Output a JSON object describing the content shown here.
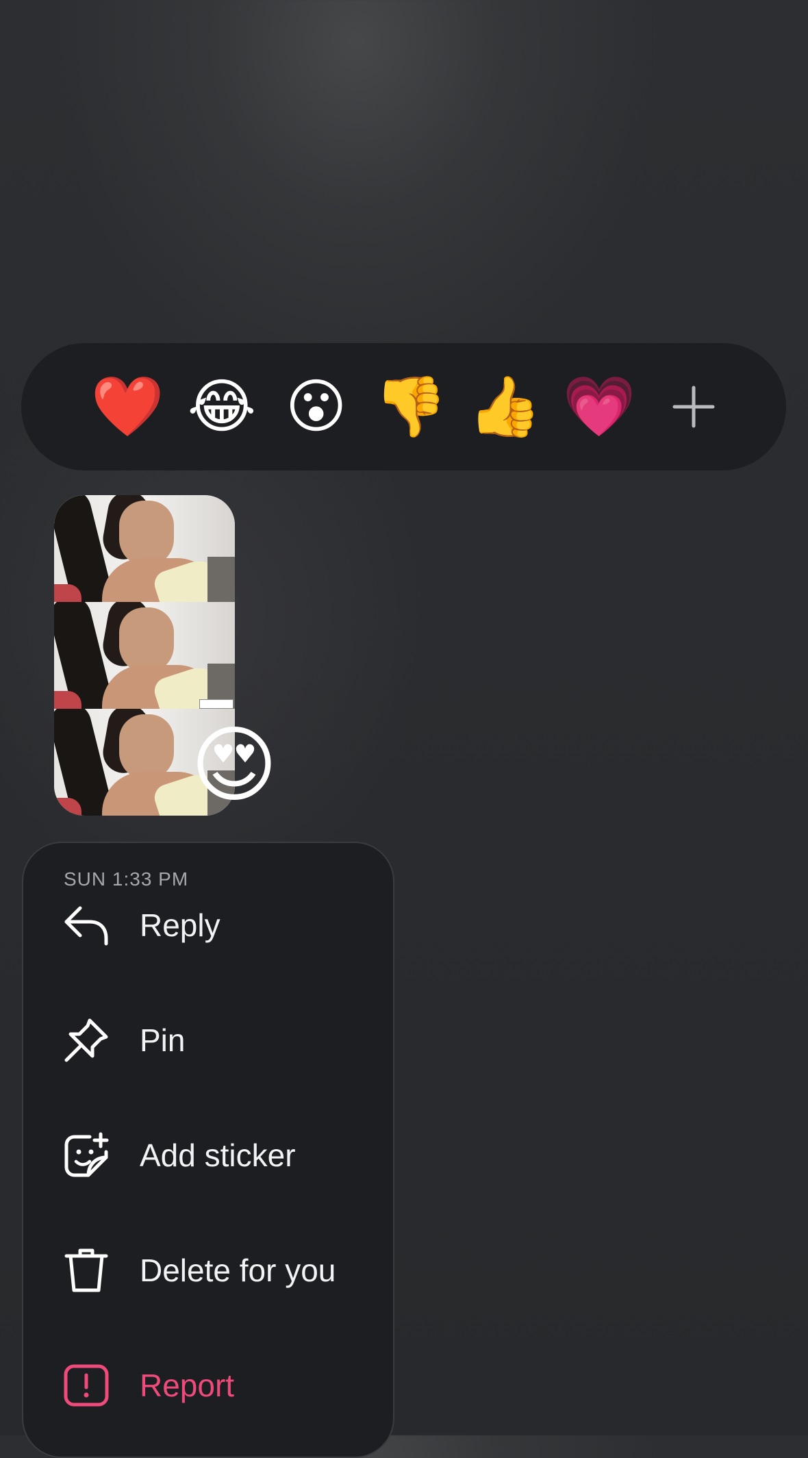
{
  "reactions": {
    "items": [
      {
        "emoji": "❤️",
        "name": "red-heart"
      },
      {
        "emoji": "😂",
        "name": "tears-of-joy"
      },
      {
        "emoji": "😮",
        "name": "surprised"
      },
      {
        "emoji": "👎",
        "name": "thumbs-down"
      },
      {
        "emoji": "👍",
        "name": "thumbs-up"
      },
      {
        "emoji": "💗",
        "name": "growing-heart"
      }
    ],
    "more_icon": "plus-icon"
  },
  "message": {
    "reaction_badge": "😍",
    "reaction_badge_name": "heart-eyes"
  },
  "menu": {
    "timestamp": "SUN 1:33 PM",
    "items": [
      {
        "label": "Reply",
        "icon": "reply-arrow-icon"
      },
      {
        "label": "Pin",
        "icon": "pin-icon"
      },
      {
        "label": "Add sticker",
        "icon": "sticker-add-icon"
      },
      {
        "label": "Delete for you",
        "icon": "trash-icon"
      },
      {
        "label": "Report",
        "icon": "report-icon"
      }
    ],
    "danger_color": "#ee4b7b"
  }
}
